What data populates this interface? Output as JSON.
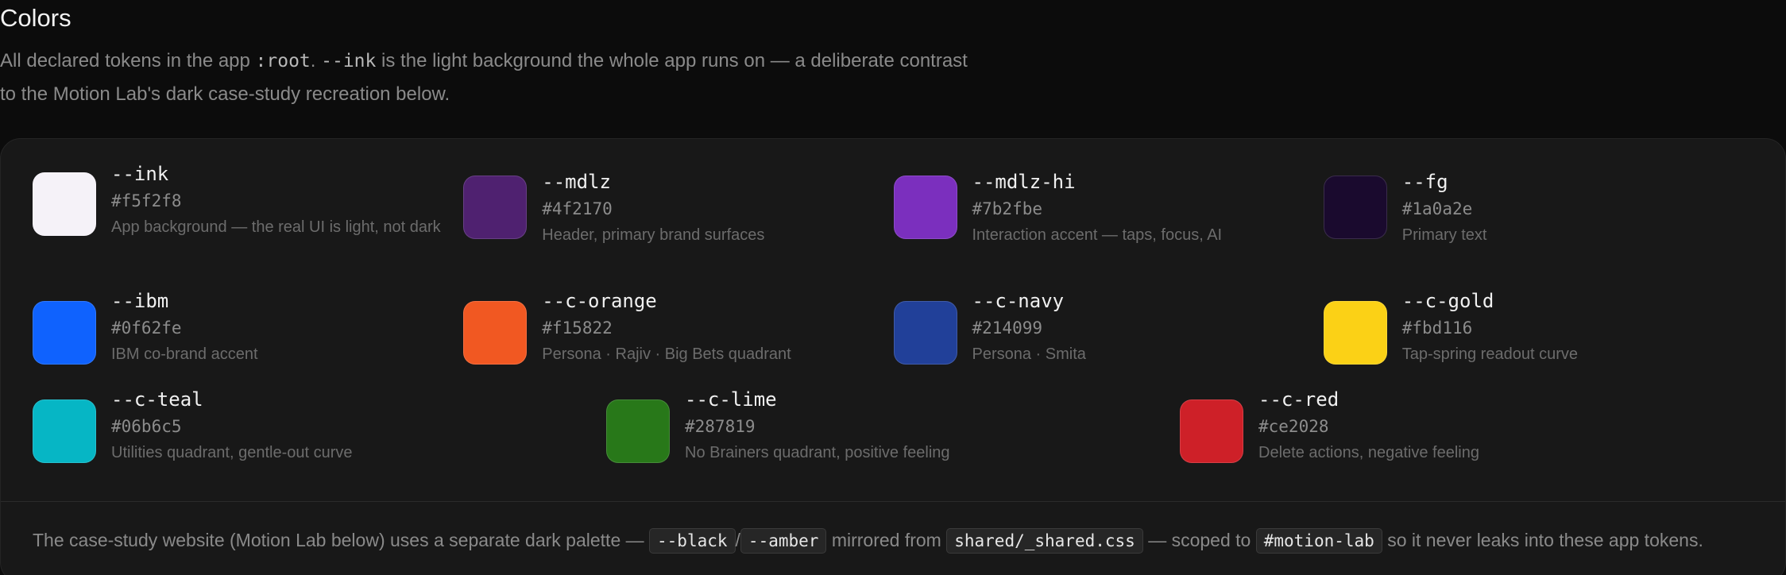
{
  "header": {
    "title": "Colors",
    "intro_1": "All declared tokens in the app ",
    "intro_code_1": ":root",
    "intro_2": ". ",
    "intro_code_2": "--ink",
    "intro_3": " is the light background the whole app runs on — a deliberate contrast to the Motion Lab's dark case-study recreation below."
  },
  "tokens": [
    {
      "name": "--ink",
      "hex": "#f5f2f8",
      "color": "#f5f2f8",
      "desc": "App background — the real UI is light, not dark"
    },
    {
      "name": "--mdlz",
      "hex": "#4f2170",
      "color": "#4f2170",
      "desc": "Header, primary brand surfaces"
    },
    {
      "name": "--mdlz-hi",
      "hex": "#7b2fbe",
      "color": "#7b2fbe",
      "desc": "Interaction accent — taps, focus, AI"
    },
    {
      "name": "--fg",
      "hex": "#1a0a2e",
      "color": "#1a0a2e",
      "desc": "Primary text"
    },
    {
      "name": "--ibm",
      "hex": "#0f62fe",
      "color": "#0f62fe",
      "desc": "IBM co-brand accent"
    },
    {
      "name": "--c-orange",
      "hex": "#f15822",
      "color": "#f15822",
      "desc": "Persona · Rajiv · Big Bets quadrant"
    },
    {
      "name": "--c-navy",
      "hex": "#214099",
      "color": "#214099",
      "desc": "Persona · Smita"
    },
    {
      "name": "--c-gold",
      "hex": "#fbd116",
      "color": "#fbd116",
      "desc": "Tap-spring readout curve"
    },
    {
      "name": "--c-teal",
      "hex": "#06b6c5",
      "color": "#06b6c5",
      "desc": "Utilities quadrant, gentle-out curve"
    },
    {
      "name": "--c-lime",
      "hex": "#287819",
      "color": "#287819",
      "desc": "No Brainers quadrant, positive feeling"
    },
    {
      "name": "--c-red",
      "hex": "#ce2028",
      "color": "#ce2028",
      "desc": "Delete actions, negative feeling"
    }
  ],
  "footer": {
    "t1": "The case-study website (Motion Lab below) uses a separate dark palette — ",
    "chip_black": "--black",
    "slash": "/",
    "chip_amber": "--amber",
    "t2": " mirrored from ",
    "chip_file": "shared/_shared.css",
    "t3": " — scoped to ",
    "chip_scope": "#motion-lab",
    "t4": " so it never leaks into these app tokens."
  }
}
